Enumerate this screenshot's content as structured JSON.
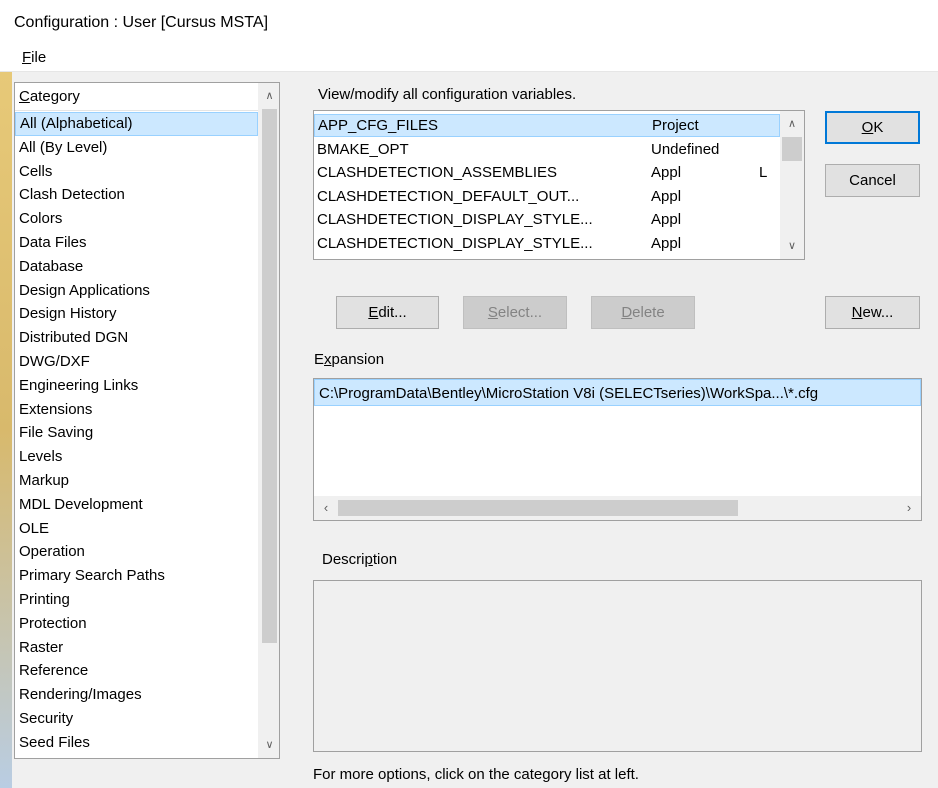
{
  "window": {
    "title": "Configuration : User [Cursus MSTA]"
  },
  "menu": {
    "file_label": "File",
    "file_mnemonic": "F",
    "file_rest": "ile"
  },
  "category": {
    "header": "Category",
    "header_mnemonic": "C",
    "header_rest": "ategory",
    "selected_index": 0,
    "items": [
      "All (Alphabetical)",
      "All (By Level)",
      "Cells",
      "Clash Detection",
      "Colors",
      "Data Files",
      "Database",
      "Design Applications",
      "Design History",
      "Distributed DGN",
      "DWG/DXF",
      "Engineering Links",
      "Extensions",
      "File Saving",
      "Levels",
      "Markup",
      "MDL Development",
      "OLE",
      "Operation",
      "Primary Search Paths",
      "Printing",
      "Protection",
      "Raster",
      "Reference",
      "Rendering/Images",
      "Security",
      "Seed Files"
    ]
  },
  "variables": {
    "label": "View/modify all configuration variables.",
    "rows": [
      {
        "name": "APP_CFG_FILES",
        "level": "Project",
        "lock": ""
      },
      {
        "name": "BMAKE_OPT",
        "level": "Undefined",
        "lock": ""
      },
      {
        "name": "CLASHDETECTION_ASSEMBLIES",
        "level": "Appl",
        "lock": "L"
      },
      {
        "name": "CLASHDETECTION_DEFAULT_OUT...",
        "level": "Appl",
        "lock": ""
      },
      {
        "name": "CLASHDETECTION_DISPLAY_STYLE...",
        "level": "Appl",
        "lock": ""
      },
      {
        "name": "CLASHDETECTION_DISPLAY_STYLE...",
        "level": "Appl",
        "lock": ""
      }
    ]
  },
  "buttons": {
    "ok": {
      "mn": "O",
      "rest": "K"
    },
    "cancel": "Cancel",
    "edit": {
      "mn": "E",
      "rest": "dit..."
    },
    "select": {
      "mn": "S",
      "rest": "elect..."
    },
    "delete": {
      "mn": "D",
      "rest": "elete"
    },
    "new": {
      "mn": "N",
      "rest": "ew..."
    }
  },
  "expansion": {
    "label_mn": "x",
    "label_pre": "E",
    "label_rest": "pansion",
    "value": "C:\\ProgramData\\Bentley\\MicroStation V8i (SELECTseries)\\WorkSpa...\\*.cfg"
  },
  "description": {
    "label_pre": "Descri",
    "label_mn": "p",
    "label_rest": "tion",
    "text": ""
  },
  "status": {
    "hint": "For more options, click on the category list at left."
  },
  "icons": {
    "scroll_up": "chevron-up-icon",
    "scroll_down": "chevron-down-icon",
    "scroll_left": "chevron-left-icon",
    "scroll_right": "chevron-right-icon"
  },
  "colors": {
    "selection": "#cce8ff",
    "selection_border": "#99d1ff",
    "default_button_border": "#0078d7"
  }
}
